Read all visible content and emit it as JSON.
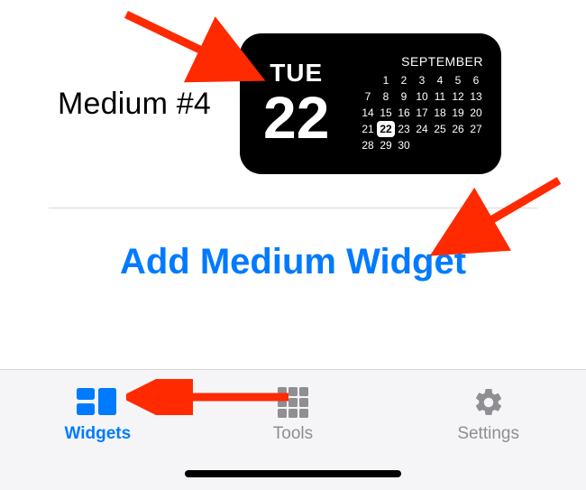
{
  "colors": {
    "accent": "#007aff",
    "inactive": "#8e8e93"
  },
  "widget": {
    "title": "Medium #4",
    "day_name": "TUE",
    "day_number": "22",
    "month": "SEPTEMBER",
    "today": 22,
    "start_offset": 1,
    "days_in_month": 30
  },
  "add_button_label": "Add Medium Widget",
  "tabs": {
    "widgets": "Widgets",
    "tools": "Tools",
    "settings": "Settings"
  },
  "icons": {
    "widgets": "widgets-icon",
    "tools": "tools-icon",
    "settings": "settings-icon"
  }
}
